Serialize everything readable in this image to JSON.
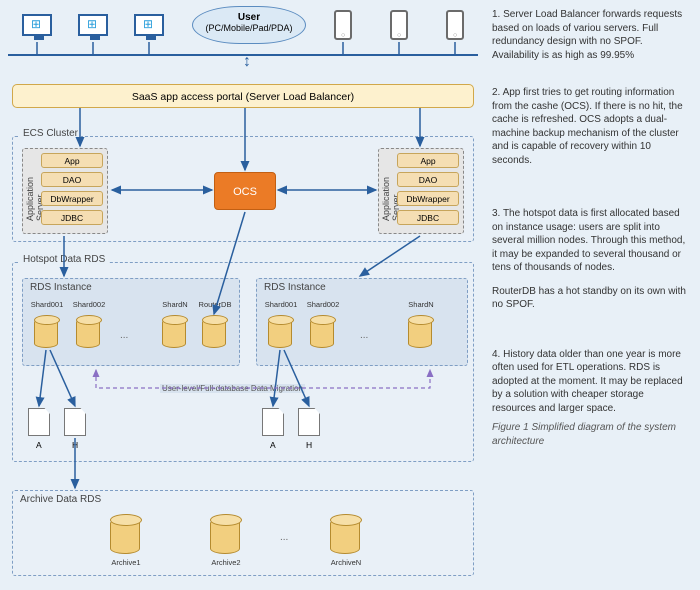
{
  "user": {
    "title": "User",
    "subtitle": "(PC/Mobile/Pad/PDA)"
  },
  "slb_label": "SaaS app access portal (Server Load Balancer)",
  "ecs": {
    "title": "ECS Cluster",
    "server_label": "Application Server",
    "stack": [
      "App",
      "DAO",
      "DbWrapper",
      "JDBC"
    ]
  },
  "ocs_label": "OCS",
  "hotspot": {
    "title": "Hotspot Data RDS",
    "instance_label": "RDS Instance",
    "left_shards": [
      "Shard001",
      "Shard002",
      "ShardN",
      "RouterDB"
    ],
    "right_shards": [
      "Shard001",
      "Shard002",
      "ShardN"
    ],
    "migration_label": "User-level/Full-database Data Migration",
    "doc_a": "A",
    "doc_h": "H"
  },
  "archive": {
    "title": "Archive Data RDS",
    "items": [
      "Archive1",
      "Archive2",
      "ArchiveN"
    ]
  },
  "notes": {
    "n1": "1. Server Load Balancer forwards requests based on loads of variou servers. Full redundancy design with no SPOF. Availability is as high as 99.95%",
    "n2": "2. App first tries to get routing information from the cashe (OCS). If there is no hit, the cache is refreshed. OCS adopts a dual-machine backup mechanism of the cluster and is capable of recovery within 10 seconds.",
    "n3a": "3. The hotspot data is first allocated based on instance usage: users are split into several million nodes. Through this method, it may be expanded to several thousand or tens of thousands of nodes.",
    "n3b": "RouterDB has a hot standby on its own with no SPOF.",
    "n4": "4. History data older than one year is more often used for ETL operations. RDS is adopted at the moment. It may be replaced by a solution with cheaper storage resources and larger space.",
    "caption": "Figure 1 Simplified diagram of the system architecture"
  }
}
